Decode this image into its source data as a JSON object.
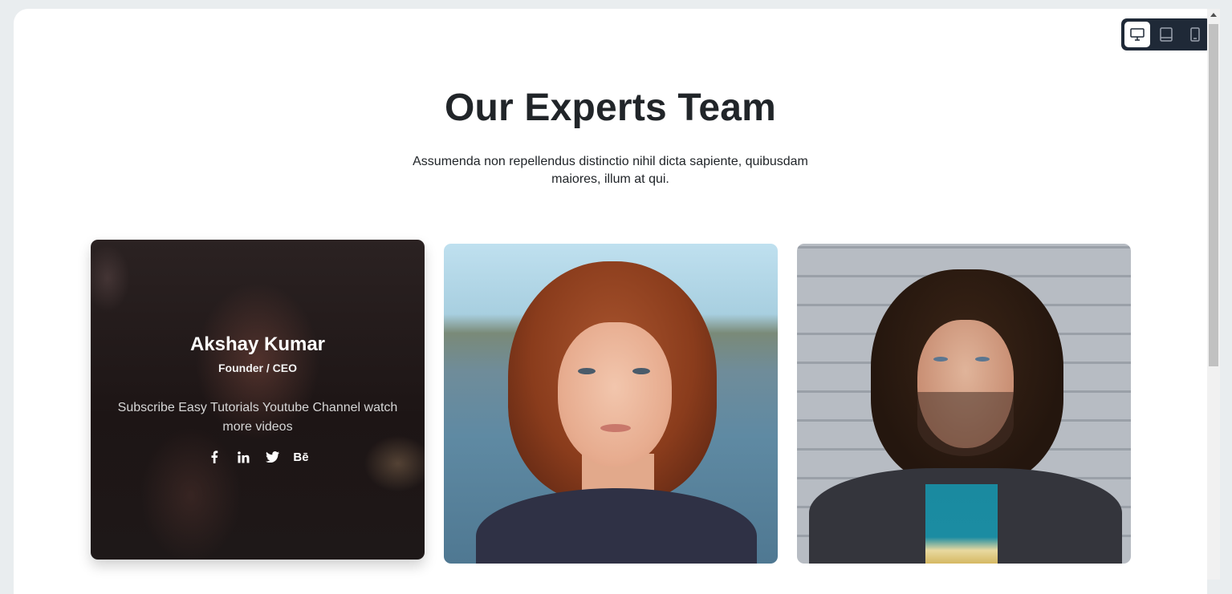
{
  "device_switcher": {
    "options": [
      {
        "name": "desktop",
        "icon": "desktop-icon",
        "active": true
      },
      {
        "name": "tablet",
        "icon": "tablet-icon",
        "active": false
      },
      {
        "name": "mobile",
        "icon": "mobile-icon",
        "active": false
      }
    ]
  },
  "section": {
    "title": "Our Experts Team",
    "subtitle": "Assumenda non repellendus distinctio nihil dicta sapiente, quibusdam maiores, illum at qui."
  },
  "team": [
    {
      "name": "Akshay Kumar",
      "role": "Founder / CEO",
      "description": "Subscribe Easy Tutorials Youtube Channel watch more videos",
      "socials": [
        {
          "icon": "facebook-icon",
          "label": "f"
        },
        {
          "icon": "linkedin-icon",
          "label": "in"
        },
        {
          "icon": "twitter-icon",
          "label": ""
        },
        {
          "icon": "behance-icon",
          "label": "Bē"
        }
      ]
    },
    {
      "photo": "woman-portrait"
    },
    {
      "photo": "man-portrait"
    }
  ],
  "colors": {
    "switcher_bg": "#1f2937",
    "heading": "#212529"
  }
}
